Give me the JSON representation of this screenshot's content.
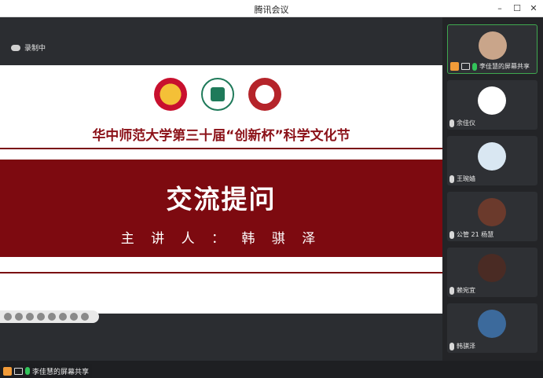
{
  "window": {
    "title": "腾讯会议",
    "controls": [
      "minimize",
      "maximize",
      "close"
    ]
  },
  "recording": {
    "label": "录制中"
  },
  "slide": {
    "subtitle": "华中师范大学第三十届“创新杯”科学文化节",
    "heading": "交流提问",
    "speaker": "主 讲 人 ： 韩 骐 泽"
  },
  "share_tag": {
    "label": "李佳慧的屏幕共享"
  },
  "participants": [
    {
      "name": "李佳慧的屏幕共享",
      "avatar_color": "#c9a58a",
      "active": true,
      "mic": "on",
      "screen": true
    },
    {
      "name": "余佳仪",
      "avatar_color": "#ffffff",
      "active": false,
      "mic": "off",
      "screen": false
    },
    {
      "name": "王琬嫱",
      "avatar_color": "#d9e7f2",
      "active": false,
      "mic": "off",
      "screen": false
    },
    {
      "name": "公管 21 杨慧",
      "avatar_color": "#6b3a2c",
      "active": false,
      "mic": "off",
      "screen": false
    },
    {
      "name": "赖宛宜",
      "avatar_color": "#4a2b24",
      "active": false,
      "mic": "off",
      "screen": false
    },
    {
      "name": "韩骐泽",
      "avatar_color": "#3c6a9c",
      "active": false,
      "mic": "on-white",
      "screen": false
    }
  ],
  "colors": {
    "accent_green": "#3fa84f",
    "slide_red": "#7d0a10"
  }
}
